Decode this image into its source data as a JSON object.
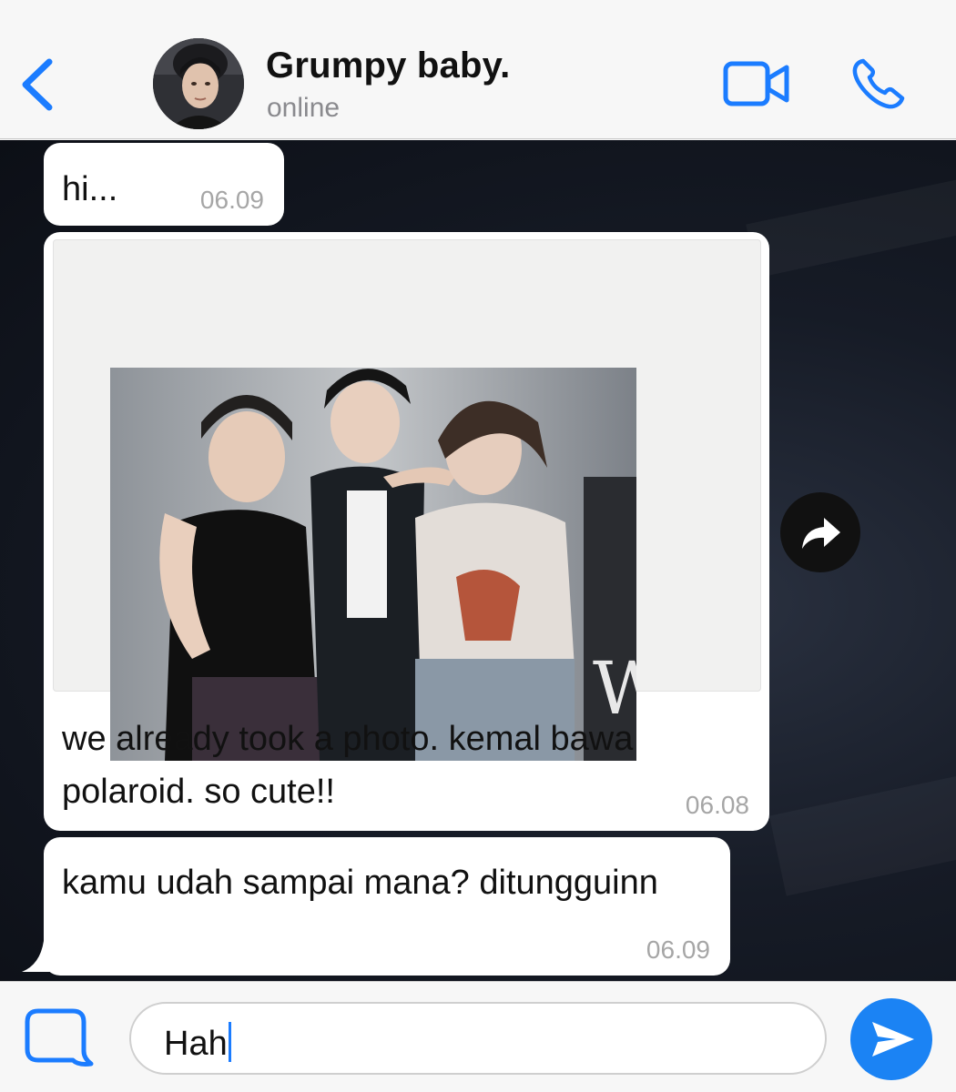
{
  "header": {
    "back_icon": "chevron-left-icon",
    "contact_name": "Grumpy baby.",
    "status": "online",
    "video_icon": "video-camera-icon",
    "call_icon": "phone-icon",
    "accent_color": "#1b7cff"
  },
  "messages": [
    {
      "text": "hi...",
      "time": "06.09",
      "has_image": false
    },
    {
      "text": "we already took a photo. kemal bawa polaroid. so cute!!",
      "time": "06.08",
      "has_image": true,
      "image": "polaroid-photo"
    },
    {
      "text": "kamu udah sampai mana? ditungguinn",
      "time": "06.09",
      "has_image": false
    }
  ],
  "actions": {
    "share_icon": "share-arrow-icon"
  },
  "composer": {
    "attach_icon": "message-square-icon",
    "input_value": "Hah",
    "send_icon": "send-icon"
  }
}
